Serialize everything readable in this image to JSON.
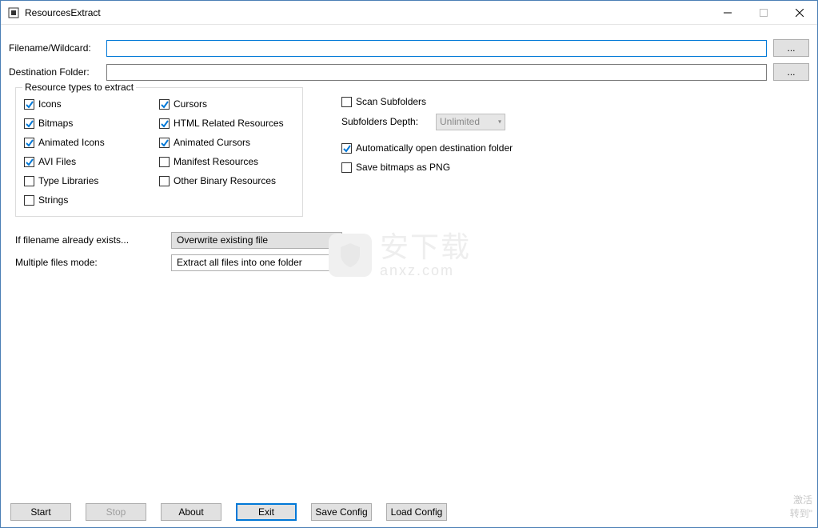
{
  "window": {
    "title": "ResourcesExtract"
  },
  "labels": {
    "filename": "Filename/Wildcard:",
    "destination": "Destination Folder:",
    "browse": "...",
    "fieldset_legend": "Resource types to extract",
    "scan_subfolders": "Scan Subfolders",
    "subfolders_depth": "Subfolders Depth:",
    "unlimited": "Unlimited",
    "auto_open": "Automatically open destination folder",
    "save_png": "Save bitmaps as PNG",
    "if_exists": "If filename already exists...",
    "multi_mode": "Multiple files mode:"
  },
  "inputs": {
    "filename_value": "",
    "destination_value": ""
  },
  "resource_types": {
    "col1": [
      {
        "label": "Icons",
        "checked": true
      },
      {
        "label": "Bitmaps",
        "checked": true
      },
      {
        "label": "Animated Icons",
        "checked": true
      },
      {
        "label": "AVI Files",
        "checked": true
      },
      {
        "label": "Type Libraries",
        "checked": false
      },
      {
        "label": "Strings",
        "checked": false
      }
    ],
    "col2": [
      {
        "label": "Cursors",
        "checked": true
      },
      {
        "label": "HTML Related Resources",
        "checked": true
      },
      {
        "label": "Animated Cursors",
        "checked": true
      },
      {
        "label": "Manifest Resources",
        "checked": false
      },
      {
        "label": "Other Binary Resources",
        "checked": false
      }
    ]
  },
  "right_checks": {
    "scan_subfolders": false,
    "auto_open": true,
    "save_png": false
  },
  "combos": {
    "overwrite": "Overwrite existing file",
    "multimode": "Extract all files into one folder"
  },
  "buttons": {
    "start": "Start",
    "stop": "Stop",
    "about": "About",
    "exit": "Exit",
    "save_config": "Save Config",
    "load_config": "Load Config"
  },
  "watermark": {
    "main": "安下载",
    "sub": "anxz.com"
  },
  "activation": {
    "line1": "激活",
    "line2": "转到\""
  }
}
